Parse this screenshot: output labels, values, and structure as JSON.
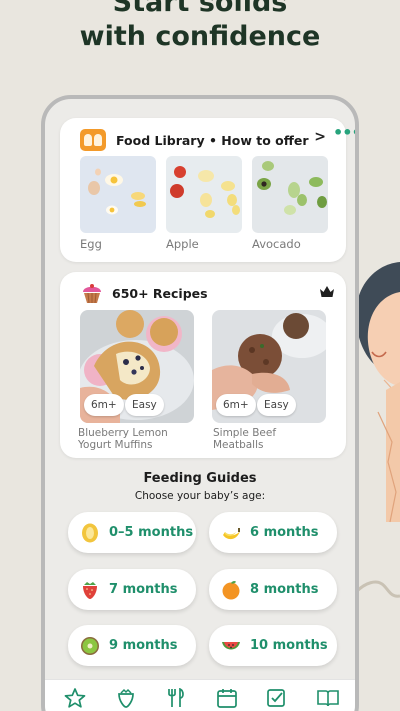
{
  "headline": {
    "line1": "Start solids",
    "line2": "with confidence"
  },
  "colors": {
    "accent": "#1f8f6b",
    "headline": "#1e3526",
    "background": "#e9e6df",
    "food_logo": "#f39a2a"
  },
  "food_library": {
    "title": "Food Library • How to offer",
    "arrow": ">",
    "more_icon": "more-dots-icon",
    "items": [
      {
        "label": "Egg"
      },
      {
        "label": "Apple"
      },
      {
        "label": "Avocado"
      }
    ]
  },
  "recipes": {
    "title": "650+ Recipes",
    "premium_icon": "crown-icon",
    "items": [
      {
        "age": "6m+",
        "level": "Easy",
        "name_line1": "Blueberry Lemon",
        "name_line2": "Yogurt Muffins"
      },
      {
        "age": "6m+",
        "level": "Easy",
        "name_line1": "Simple Beef",
        "name_line2": "Meatballs"
      }
    ]
  },
  "feeding_guides": {
    "title": "Feeding Guides",
    "subtitle": "Choose your baby’s age:",
    "options": [
      {
        "label": "0–5 months",
        "icon": "bottle-icon"
      },
      {
        "label": "6 months",
        "icon": "banana-icon"
      },
      {
        "label": "7 months",
        "icon": "strawberry-icon"
      },
      {
        "label": "8 months",
        "icon": "orange-icon"
      },
      {
        "label": "9 months",
        "icon": "kiwi-icon"
      },
      {
        "label": "10 months",
        "icon": "watermelon-icon"
      }
    ]
  },
  "tab_bar": {
    "icons": [
      "star-icon",
      "strawberry-outline-icon",
      "utensils-icon",
      "calendar-icon",
      "checklist-icon",
      "book-icon"
    ]
  }
}
